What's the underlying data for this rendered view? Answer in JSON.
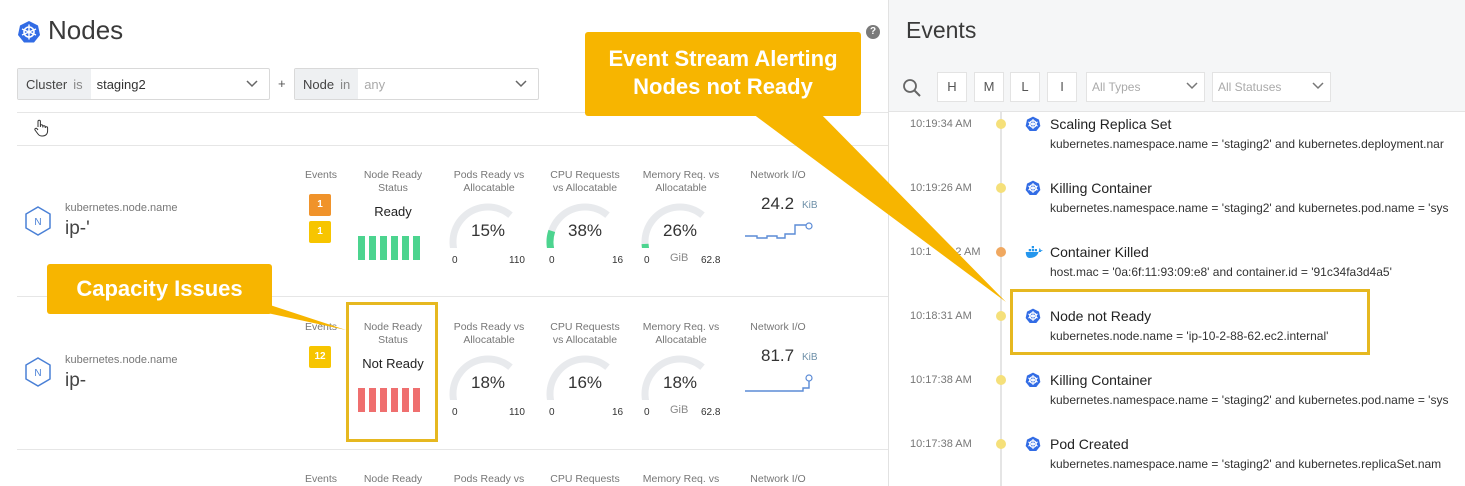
{
  "nodes_panel": {
    "title": "Nodes",
    "help": "?",
    "filters": [
      {
        "label": "Cluster",
        "op": "is",
        "value": "staging2"
      },
      {
        "label": "Node",
        "op": "in",
        "value": "any"
      }
    ],
    "plus": "+",
    "columns": {
      "events": "Events",
      "node_ready_1": "Node Ready",
      "node_ready_2": "Status",
      "pods_1": "Pods Ready vs",
      "pods_2": "Allocatable",
      "cpu_1": "CPU Requests",
      "cpu_2": "vs Allocatable",
      "mem_1": "Memory Req. vs",
      "mem_2": "Allocatable",
      "net": "Network I/O"
    },
    "rows": [
      {
        "node_label": "kubernetes.node.name",
        "node_value": "ip-'",
        "hex_letter": "N",
        "badges": [
          {
            "value": "1",
            "color": "#f0932b"
          },
          {
            "value": "1",
            "color": "#f7c500"
          }
        ],
        "status": "Ready",
        "bar_color": "#4cd48f",
        "pods": {
          "pct": "15%",
          "fraction": 0.15,
          "min": "0",
          "max": "110"
        },
        "cpu": {
          "pct": "38%",
          "fraction": 0.38,
          "min": "0",
          "max": "16"
        },
        "mem": {
          "pct": "26%",
          "fraction": 0.26,
          "min": "0",
          "unit": "GiB",
          "max": "62.8"
        },
        "net": {
          "value": "24.2",
          "unit": "KiB"
        }
      },
      {
        "node_label": "kubernetes.node.name",
        "node_value": "ip-",
        "hex_letter": "N",
        "badges": [
          {
            "value": "12",
            "color": "#f7c500"
          }
        ],
        "status": "Not Ready",
        "bar_color": "#ef6f6f",
        "pods": {
          "pct": "18%",
          "fraction": 0.18,
          "min": "0",
          "max": "110"
        },
        "cpu": {
          "pct": "16%",
          "fraction": 0.16,
          "min": "0",
          "max": "16"
        },
        "mem": {
          "pct": "18%",
          "fraction": 0.18,
          "min": "0",
          "unit": "GiB",
          "max": "62.8"
        },
        "net": {
          "value": "81.7",
          "unit": "KiB"
        }
      }
    ],
    "partial_row": {
      "events": "Events",
      "node_ready": "Node Ready",
      "pods": "Pods Ready vs",
      "cpu": "CPU Requests",
      "mem": "Memory Req. vs",
      "net": "Network I/O"
    }
  },
  "annotations": {
    "capacity": "Capacity Issues",
    "stream_1": "Event Stream Alerting",
    "stream_2": "Nodes not Ready",
    "color": "#f7b500"
  },
  "events_panel": {
    "title": "Events",
    "buttons": [
      "H",
      "M",
      "L",
      "I"
    ],
    "type_select": "All Types",
    "status_select": "All Statuses",
    "events": [
      {
        "time": "10:19:34 AM",
        "dot": "#f5e07a",
        "icon": "k8s",
        "title": "Scaling Replica Set",
        "desc": "kubernetes.namespace.name = 'staging2' and kubernetes.deployment.nar"
      },
      {
        "time": "10:19:26 AM",
        "dot": "#f5e07a",
        "icon": "k8s",
        "title": "Killing Container",
        "desc": "kubernetes.namespace.name = 'staging2' and kubernetes.pod.name = 'sys"
      },
      {
        "time": "10:1",
        "time_tail": "2 AM",
        "dot": "#f0a860",
        "icon": "docker",
        "title": "Container Killed",
        "desc": "host.mac = '0a:6f:11:93:09:e8' and container.id = '91c34fa3d4a5'"
      },
      {
        "time": "10:18:31 AM",
        "dot": "#f5e07a",
        "icon": "k8s",
        "title": "Node not Ready",
        "desc": "kubernetes.node.name = 'ip-10-2-88-62.ec2.internal'"
      },
      {
        "time": "10:17:38 AM",
        "dot": "#f5e07a",
        "icon": "k8s",
        "title": "Killing Container",
        "desc": "kubernetes.namespace.name = 'staging2' and kubernetes.pod.name = 'sys"
      },
      {
        "time": "10:17:38 AM",
        "dot": "#f5e07a",
        "icon": "k8s",
        "title": "Pod Created",
        "desc": "kubernetes.namespace.name = 'staging2' and kubernetes.replicaSet.nam"
      }
    ]
  },
  "colors": {
    "k8s_blue": "#326ce5",
    "gauge_green": "#4cd48f",
    "gauge_track": "#e8eaed",
    "highlight": "#e6b820"
  }
}
